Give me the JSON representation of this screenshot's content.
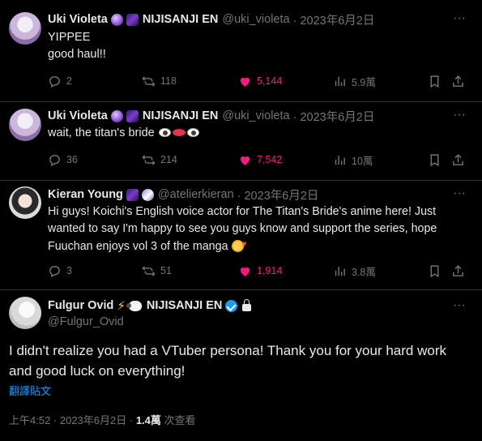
{
  "tweets": [
    {
      "author": "Uki Violeta",
      "handle": "@uki_violeta",
      "timestamp": "· 2023年6月2日",
      "badges": [
        "purple-orb-emoji",
        "galaxy-emoji"
      ],
      "affiliation": "NIJISANJI EN",
      "text_lines": [
        "YIPPEE",
        "good haul!!"
      ],
      "replies": "2",
      "reposts": "118",
      "likes": "5,144",
      "views": "5.9萬"
    },
    {
      "author": "Uki Violeta",
      "handle": "@uki_violeta",
      "timestamp": "· 2023年6月2日",
      "badges": [
        "purple-orb-emoji",
        "galaxy-emoji"
      ],
      "affiliation": "NIJISANJI EN",
      "text_lines": [
        "wait, the titan's bride"
      ],
      "replies": "36",
      "reposts": "214",
      "likes": "7,542",
      "views": "10萬"
    },
    {
      "author": "Kieran Young",
      "handle": "@atelierkieran",
      "timestamp": "· 2023年6月2日",
      "badges": [
        "galaxy-emoji",
        "microphone-emoji"
      ],
      "text_lines": [
        "Hi guys! Koichi's English voice actor for The Titan's Bride's anime here! Just",
        "wanted to say I'm happy to see you guys know and support the series, hope",
        "Fuuchan enjoys vol 3 of the manga"
      ],
      "replies": "3",
      "reposts": "51",
      "likes": "1,914",
      "views": "3.8萬"
    }
  ],
  "main_tweet": {
    "author": "Fulgur Ovid",
    "affiliation": "NIJISANJI EN",
    "handle": "@Fulgur_Ovid",
    "text_lines": [
      "I didn't realize you had a VTuber persona! Thank you for your hard work",
      "and good luck on everything!"
    ],
    "translate_label": "翻譯貼文",
    "time": "上午4:52 · 2023年6月2日 ·",
    "views_count": "1.4萬",
    "views_label": "次查看"
  },
  "colors": {
    "background": "#000000",
    "text": "#e7e9ea",
    "muted": "#71767b",
    "like": "#f91880",
    "link": "#1d9bf0",
    "divider": "#2f3336"
  }
}
